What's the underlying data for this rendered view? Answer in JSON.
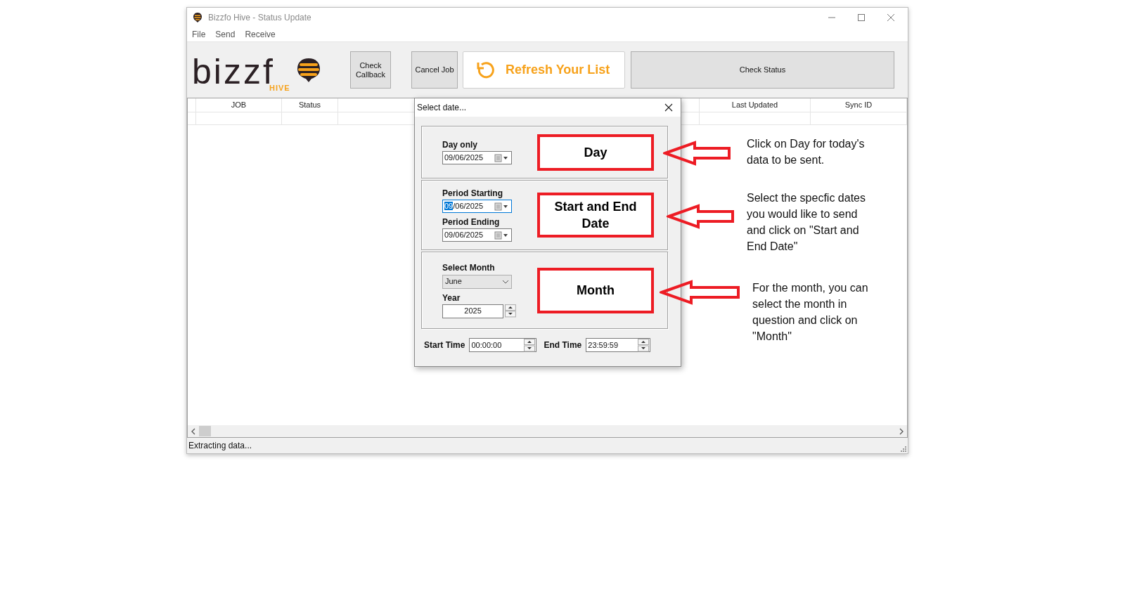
{
  "window": {
    "title": "Bizzfo Hive - Status Update"
  },
  "menu": [
    "File",
    "Send",
    "Receive"
  ],
  "logo": {
    "wordmark": "bizzf",
    "tagline": "HIVE"
  },
  "toolbar": [
    {
      "label": "Check Callback",
      "kind": "plain"
    },
    {
      "label": "Cancel Job",
      "kind": "plain"
    },
    {
      "label": "Refresh Your List",
      "kind": "refresh"
    },
    {
      "label": "Check Status",
      "kind": "wide"
    }
  ],
  "grid": {
    "columns": [
      {
        "label": "JOB"
      },
      {
        "label": "Status"
      },
      {},
      {
        "label": "Last Updated"
      },
      {
        "label": "Sync ID"
      }
    ]
  },
  "status_bar": "Extracting data...",
  "dialog": {
    "title": "Select date...",
    "groups": [
      {
        "kind": "day",
        "fields": [
          {
            "label": "Day only",
            "value": "09/06/2025",
            "focused": false
          }
        ],
        "button": "Day"
      },
      {
        "kind": "period",
        "fields": [
          {
            "label": "Period Starting",
            "value": "09/06/2025",
            "focused": true
          },
          {
            "label": "Period Ending",
            "value": "09/06/2025",
            "focused": false
          }
        ],
        "button": "Start and End Date"
      },
      {
        "kind": "month",
        "month_label": "Select Month",
        "month": "June",
        "year_label": "Year",
        "year": "2025",
        "button": "Month"
      }
    ],
    "times": [
      {
        "label": "Start Time",
        "value": "00:00:00"
      },
      {
        "label": "End Time",
        "value": "23:59:59"
      }
    ]
  },
  "annotations": [
    "Click on Day for today's data to be sent.",
    "Select the specfic dates you would like to send and click on \"Start and End Date\"",
    "For the month, you can select the month in question and click on \"Month\""
  ]
}
